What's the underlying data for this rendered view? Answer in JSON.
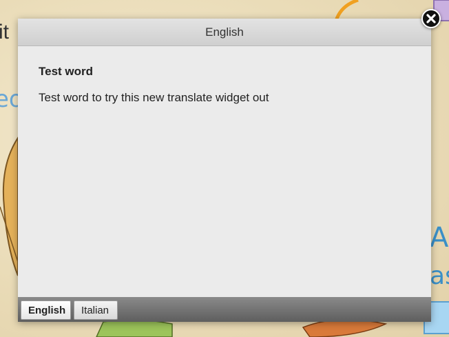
{
  "dialog": {
    "title": "English",
    "entry": {
      "word": "Test word",
      "definition": "Test word to try this new translate widget out"
    },
    "languages": [
      {
        "label": "English",
        "active": true
      },
      {
        "label": "Italian",
        "active": false
      }
    ],
    "close_icon": "close-icon"
  },
  "background": {
    "fragments": [
      "it",
      "A",
      "as"
    ]
  },
  "colors": {
    "header_bg": "#d8d8d8",
    "body_bg": "#ebebeb",
    "footer_bg": "#6e6e6e",
    "accent_blue": "#3a8fc7",
    "accent_orange": "#f0a020"
  }
}
